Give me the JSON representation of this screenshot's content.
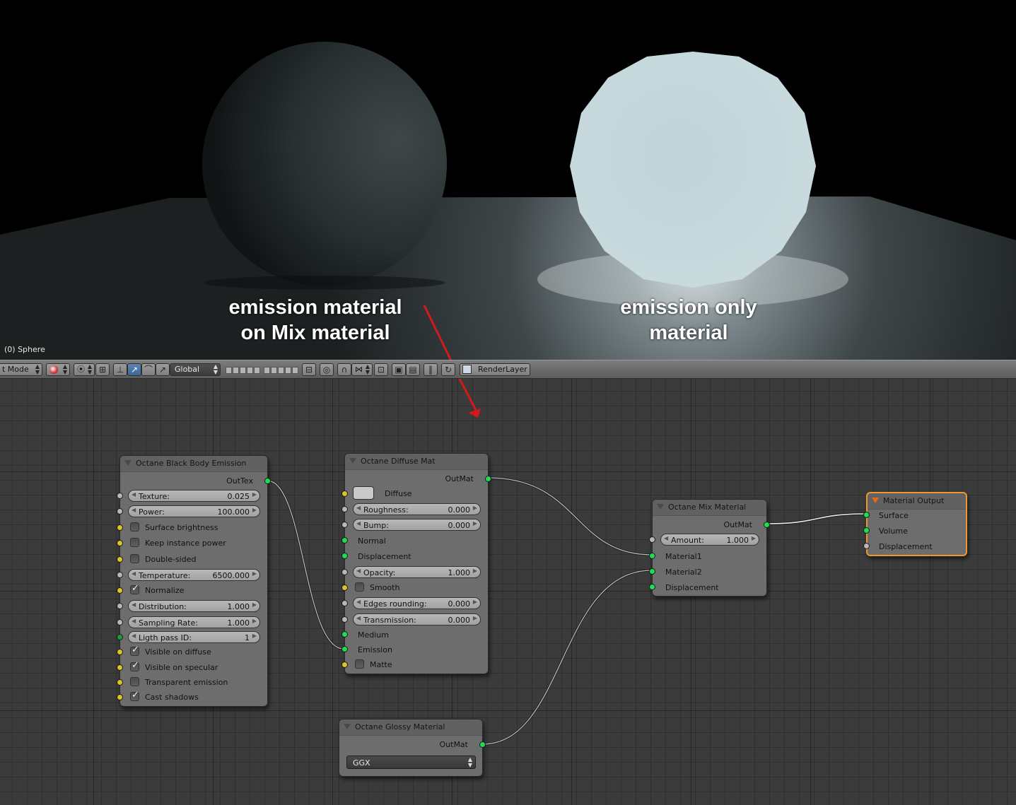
{
  "viewport": {
    "object_label": "(0) Sphere",
    "annotation_left": [
      "emission material",
      "on Mix material"
    ],
    "annotation_right": [
      "emission only",
      "material"
    ]
  },
  "header": {
    "mode_label": "t Mode",
    "orientation": "Global",
    "render_layer": "RenderLayer",
    "icons": [
      "viewport-shading-icon",
      "pivot-icon",
      "manipulator-icon",
      "translate-icon",
      "rotate-icon",
      "scale-icon",
      "layers-icon",
      "lock-icon",
      "proportional-icon",
      "snap-icon",
      "render-icon",
      "anim-render-icon",
      "pause-icon",
      "refresh-icon"
    ]
  },
  "nodes": {
    "blackbody": {
      "title": "Octane Black Body Emission",
      "output": "OutTex",
      "texture": {
        "label": "Texture:",
        "value": "0.025"
      },
      "power": {
        "label": "Power:",
        "value": "100.000"
      },
      "surface_brightness": {
        "label": "Surface brightness",
        "checked": false
      },
      "keep_instance_power": {
        "label": "Keep instance power",
        "checked": false
      },
      "double_sided": {
        "label": "Double-sided",
        "checked": false
      },
      "temperature": {
        "label": "Temperature:",
        "value": "6500.000"
      },
      "normalize": {
        "label": "Normalize",
        "checked": true
      },
      "distribution": {
        "label": "Distribution:",
        "value": "1.000"
      },
      "sampling_rate": {
        "label": "Sampling Rate:",
        "value": "1.000"
      },
      "light_pass_id": {
        "label": "Ligth pass ID:",
        "value": "1"
      },
      "visible_on_diffuse": {
        "label": "Visible on diffuse",
        "checked": true
      },
      "visible_on_specular": {
        "label": "Visible on specular",
        "checked": true
      },
      "transparent_emission": {
        "label": "Transparent emission",
        "checked": false
      },
      "cast_shadows": {
        "label": "Cast shadows",
        "checked": true
      }
    },
    "diffuse": {
      "title": "Octane Diffuse Mat",
      "output": "OutMat",
      "diffuse": {
        "label": "Diffuse",
        "color": "#c9c9c9"
      },
      "roughness": {
        "label": "Roughness:",
        "value": "0.000"
      },
      "bump": {
        "label": "Bump:",
        "value": "0.000"
      },
      "normal": "Normal",
      "displacement": "Displacement",
      "opacity": {
        "label": "Opacity:",
        "value": "1.000"
      },
      "smooth": {
        "label": "Smooth",
        "checked": false
      },
      "edges_rounding": {
        "label": "Edges rounding:",
        "value": "0.000"
      },
      "transmission": {
        "label": "Transmission:",
        "value": "0.000"
      },
      "medium": "Medium",
      "emission": "Emission",
      "matte": {
        "label": "Matte",
        "checked": false
      }
    },
    "glossy": {
      "title": "Octane Glossy Material",
      "output": "OutMat",
      "brdf": "GGX"
    },
    "mix": {
      "title": "Octane Mix Material",
      "output": "OutMat",
      "amount": {
        "label": "Amount:",
        "value": "1.000"
      },
      "material1": "Material1",
      "material2": "Material2",
      "displacement": "Displacement"
    },
    "output": {
      "title": "Material Output",
      "surface": "Surface",
      "volume": "Volume",
      "displacement": "Displacement"
    }
  },
  "colors": {
    "socket_shader": "#1fdc55",
    "socket_float": "#b7b7b7",
    "socket_bool": "#d9c42a",
    "selected_outline": "#f0962f",
    "annotation_arrow": "#d21a1a"
  }
}
